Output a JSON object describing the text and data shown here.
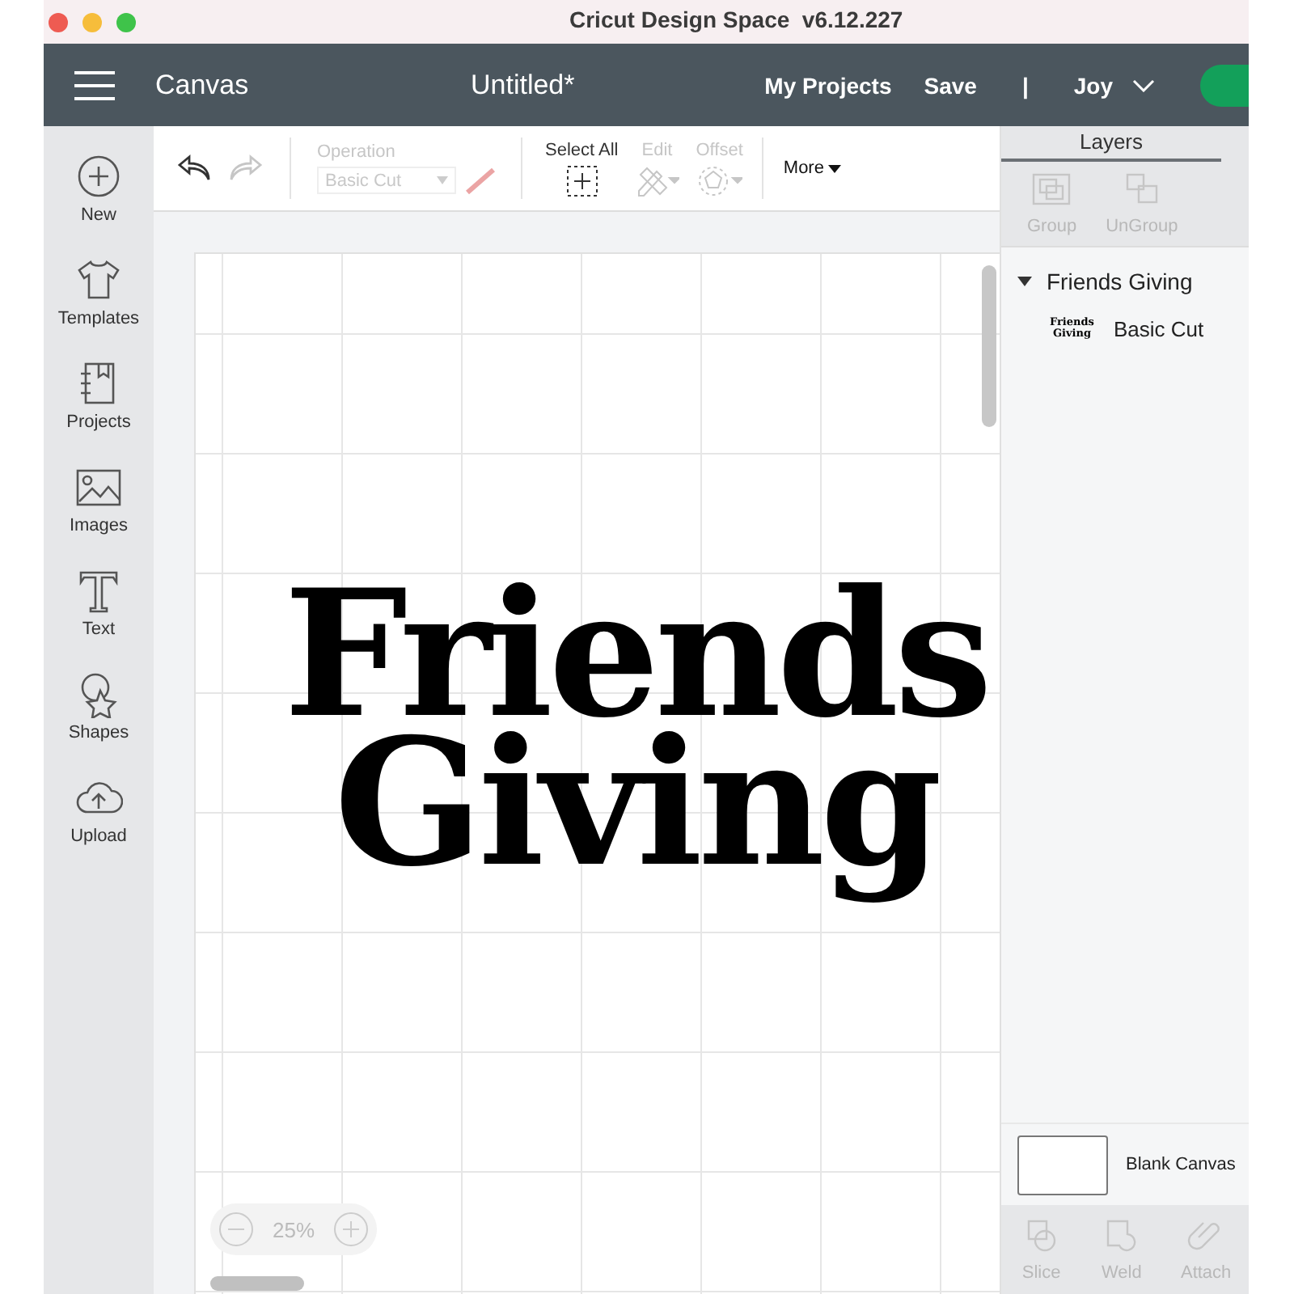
{
  "window": {
    "title": "Cricut Design Space  v6.12.227"
  },
  "header": {
    "section": "Canvas",
    "document": "Untitled*",
    "links": [
      "My Projects",
      "Save",
      "|"
    ],
    "user": "Joy"
  },
  "sidebar": {
    "items": [
      {
        "label": "New",
        "kind": "new"
      },
      {
        "label": "Templates",
        "kind": "templates"
      },
      {
        "label": "Projects",
        "kind": "projects"
      },
      {
        "label": "Images",
        "kind": "images"
      },
      {
        "label": "Text",
        "kind": "text"
      },
      {
        "label": "Shapes",
        "kind": "shapes"
      },
      {
        "label": "Upload",
        "kind": "upload"
      }
    ]
  },
  "toolbar": {
    "history": [
      {
        "kind": "undo",
        "disabled": false
      },
      {
        "kind": "redo",
        "disabled": true
      }
    ],
    "operation": {
      "label": "Operation",
      "value": "Basic Cut",
      "disabled": true
    },
    "tools": [
      {
        "label": "Select All",
        "kind": "select-all",
        "disabled": false
      },
      {
        "label": "Edit",
        "kind": "edit",
        "disabled": true
      },
      {
        "label": "Offset",
        "kind": "offset",
        "disabled": true
      }
    ],
    "more": "More"
  },
  "canvas": {
    "text_lines": [
      "Friends",
      "Giving"
    ],
    "zoom": "25%"
  },
  "layers": {
    "title": "Layers",
    "actions": [
      {
        "label": "Group",
        "kind": "group",
        "disabled": true
      },
      {
        "label": "UnGroup",
        "kind": "ungroup",
        "disabled": true
      }
    ],
    "groups": [
      {
        "name": "Friends Giving",
        "expanded": true,
        "children": [
          {
            "name": "Basic Cut",
            "thumbnail": [
              "Friends",
              "Giving"
            ]
          }
        ]
      }
    ],
    "blank_canvas": "Blank Canvas",
    "bottom_actions": [
      {
        "label": "Slice",
        "kind": "slice",
        "disabled": true
      },
      {
        "label": "Weld",
        "kind": "weld",
        "disabled": true
      },
      {
        "label": "Attach",
        "kind": "attach",
        "disabled": true
      }
    ]
  }
}
